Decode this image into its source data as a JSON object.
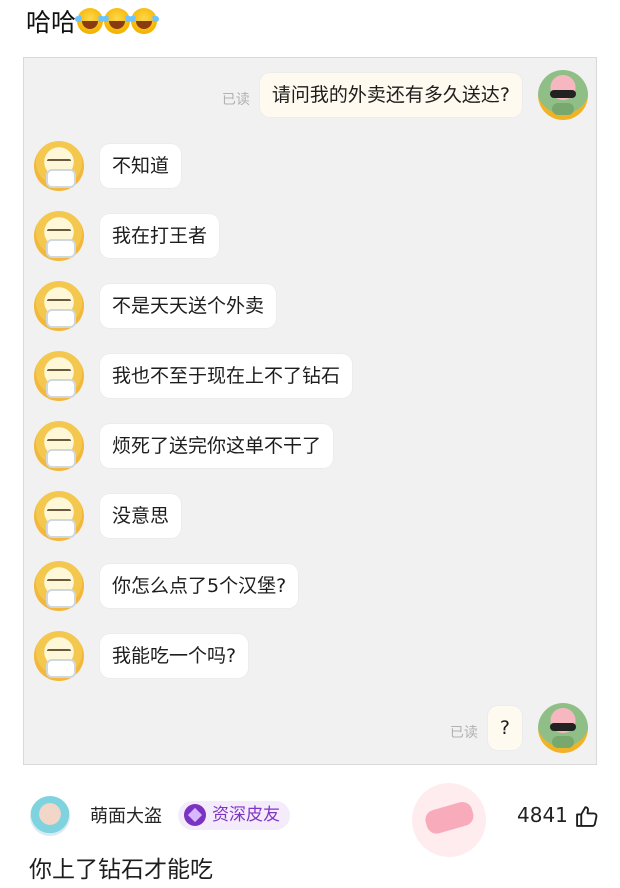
{
  "post": {
    "title": "哈哈"
  },
  "chat": {
    "read_label": "已读",
    "sent_question": "请问我的外卖还有多久送达?",
    "replies": [
      "不知道",
      "我在打王者",
      "不是天天送个外卖",
      "我也不至于现在上不了钻石",
      "烦死了送完你这单不干了",
      "没意思",
      "你怎么点了5个汉堡?",
      "我能吃一个吗?"
    ],
    "sent_mark": "?"
  },
  "comment": {
    "username": "萌面大盗",
    "badge": "资深皮友",
    "likes": "4841",
    "text": "你上了钻石才能吃"
  }
}
